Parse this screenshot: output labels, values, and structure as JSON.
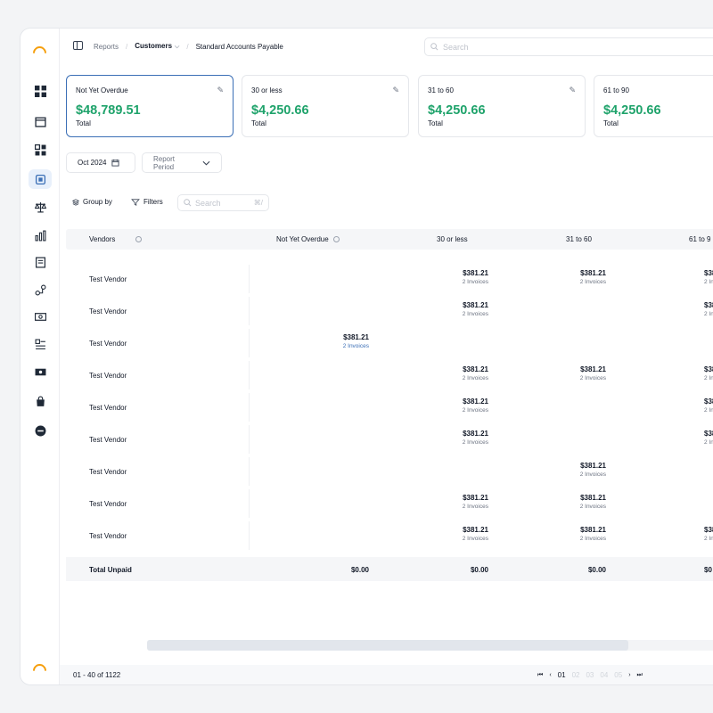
{
  "breadcrumb": {
    "items": [
      "Reports",
      "Customers",
      "Standard Accounts Payable"
    ]
  },
  "search": {
    "placeholder": "Search"
  },
  "cards": [
    {
      "label": "Not Yet Overdue",
      "amount": "$48,789.51",
      "sub": "Total"
    },
    {
      "label": "30 or less",
      "amount": "$4,250.66",
      "sub": "Total"
    },
    {
      "label": "31 to 60",
      "amount": "$4,250.66",
      "sub": "Total"
    },
    {
      "label": "61 to 90",
      "amount": "$4,250.66",
      "sub": "Total"
    }
  ],
  "filters": {
    "date": "Oct 2024",
    "period": "Report Period"
  },
  "toolbar": {
    "group_by": "Group by",
    "filters": "Filters",
    "search_placeholder": "Search",
    "shortcut": "⌘/"
  },
  "table": {
    "columns": [
      "Vendors",
      "Not Yet Overdue",
      "30 or less",
      "31 to 60",
      "61 to 9"
    ],
    "rows": [
      {
        "vendor": "Test Vendor",
        "cells": [
          null,
          {
            "amt": "$381.21",
            "inv": "2 Invoices"
          },
          {
            "amt": "$381.21",
            "inv": "2 Invoices"
          },
          {
            "amt": "$38",
            "inv": "2 Invo"
          }
        ]
      },
      {
        "vendor": "Test Vendor",
        "cells": [
          null,
          {
            "amt": "$381.21",
            "inv": "2 Invoices"
          },
          null,
          {
            "amt": "$38",
            "inv": "2 Invo"
          }
        ]
      },
      {
        "vendor": "Test Vendor",
        "cells": [
          {
            "amt": "$381.21",
            "inv": "2 Invoices",
            "link": true
          },
          null,
          null,
          null
        ]
      },
      {
        "vendor": "Test Vendor",
        "cells": [
          null,
          {
            "amt": "$381.21",
            "inv": "2 Invoices"
          },
          {
            "amt": "$381.21",
            "inv": "2 Invoices"
          },
          {
            "amt": "$38",
            "inv": "2 Invo"
          }
        ]
      },
      {
        "vendor": "Test Vendor",
        "cells": [
          null,
          {
            "amt": "$381.21",
            "inv": "2 Invoices"
          },
          null,
          {
            "amt": "$38",
            "inv": "2 Invo"
          }
        ]
      },
      {
        "vendor": "Test Vendor",
        "cells": [
          null,
          {
            "amt": "$381.21",
            "inv": "2 Invoices"
          },
          null,
          {
            "amt": "$38",
            "inv": "2 Invo"
          }
        ]
      },
      {
        "vendor": "Test Vendor",
        "cells": [
          null,
          null,
          {
            "amt": "$381.21",
            "inv": "2 Invoices"
          },
          null
        ]
      },
      {
        "vendor": "Test Vendor",
        "cells": [
          null,
          {
            "amt": "$381.21",
            "inv": "2 Invoices"
          },
          {
            "amt": "$381.21",
            "inv": "2 Invoices"
          },
          null
        ]
      },
      {
        "vendor": "Test Vendor",
        "cells": [
          null,
          {
            "amt": "$381.21",
            "inv": "2 Invoices"
          },
          {
            "amt": "$381.21",
            "inv": "2 Invoices"
          },
          {
            "amt": "$38",
            "inv": "2 Invo"
          }
        ]
      }
    ],
    "total": {
      "label": "Total Unpaid",
      "values": [
        "$0.00",
        "$0.00",
        "$0.00",
        "$0"
      ]
    }
  },
  "footer": {
    "range": "01 - 40 of 1122",
    "pages": [
      "01",
      "02",
      "03",
      "04",
      "05"
    ],
    "active_page": "01"
  },
  "colors": {
    "accent": "#3b6fb6",
    "positive": "#1fa36b",
    "logo": "#f59e0b"
  }
}
